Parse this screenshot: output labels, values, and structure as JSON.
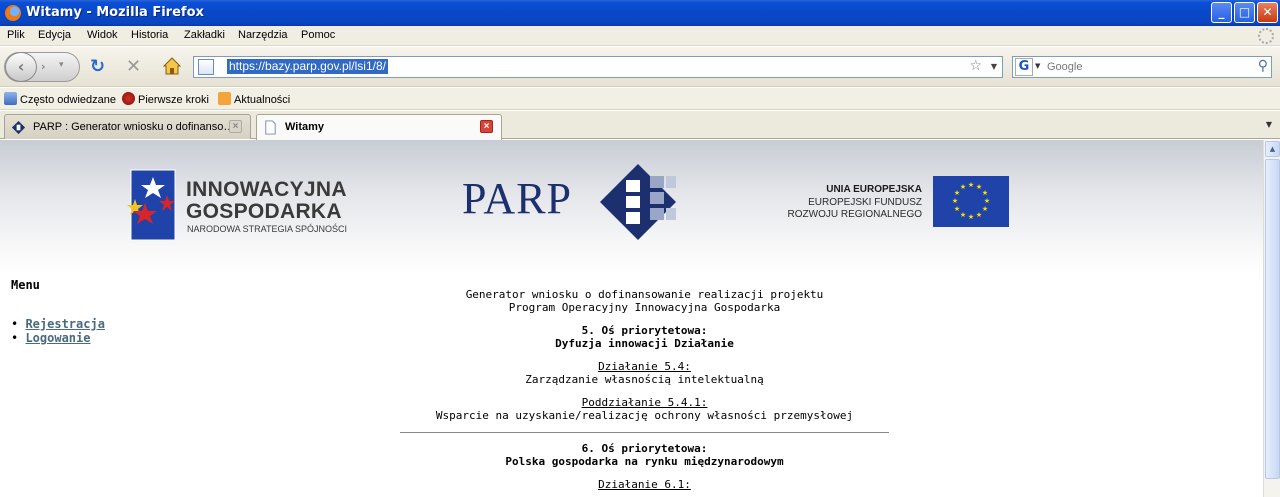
{
  "window": {
    "title": "Witamy - Mozilla Firefox",
    "buttons": {
      "minimize": "_",
      "maximize": "□",
      "close": "✕"
    }
  },
  "menubar": [
    "Plik",
    "Edycja",
    "Widok",
    "Historia",
    "Zakładki",
    "Narzędzia",
    "Pomoc"
  ],
  "toolbar": {
    "url": "https://bazy.parp.gov.pl/lsi1/8/",
    "search_placeholder": "Google",
    "icons": [
      "back-icon",
      "forward-icon",
      "reload-icon",
      "stop-icon",
      "home-icon",
      "bookmark-star-icon",
      "search-icon"
    ]
  },
  "bookmarks": [
    {
      "label": "Często odwiedzane",
      "icon": "frequent-icon"
    },
    {
      "label": "Pierwsze kroki",
      "icon": "firefox-icon"
    },
    {
      "label": "Aktualności",
      "icon": "rss-icon"
    }
  ],
  "tabs": [
    {
      "label": "PARP : Generator wniosku o dofinanso…",
      "active": false
    },
    {
      "label": "Witamy",
      "active": true
    }
  ],
  "page": {
    "logos": {
      "ig": {
        "line1": "INNOWACYJNA",
        "line2": "GOSPODARKA",
        "line3": "NARODOWA STRATEGIA SPÓJNOŚCI"
      },
      "parp": {
        "text": "PARP"
      },
      "ue": {
        "line1": "UNIA EUROPEJSKA",
        "line2": "EUROPEJSKI FUNDUSZ",
        "line3": "ROZWOJU REGIONALNEGO"
      }
    },
    "menu": {
      "title": "Menu",
      "items": [
        "Rejestracja",
        "Logowanie"
      ]
    },
    "content": {
      "intro_line1": "Generator wniosku o dofinansowanie realizacji projektu",
      "intro_line2": "Program Operacyjny Innowacyjna Gospodarka",
      "axis5_label": "5. Oś priorytetowa:",
      "axis5_name": "Dyfuzja innowacji Działanie",
      "action_label": "Działanie 5.4:",
      "action_name": "Zarządzanie własnością intelektualną",
      "subaction_label": "Poddziałanie 5.4.1:",
      "subaction_name": "Wsparcie na uzyskanie/realizację ochrony własności przemysłowej",
      "axis6_label": "6. Oś priorytetowa:",
      "axis6_name": "Polska gospodarka na rynku międzynarodowym",
      "action6_label": "Działanie 6.1:"
    }
  },
  "colors": {
    "titlebar": "#0a4fd6",
    "url_selection": "#316ac5",
    "menu_link": "#4a6a80",
    "parp_navy": "#1c2f6e",
    "eu_blue": "#1f43a8",
    "eu_star": "#ffdd00"
  }
}
